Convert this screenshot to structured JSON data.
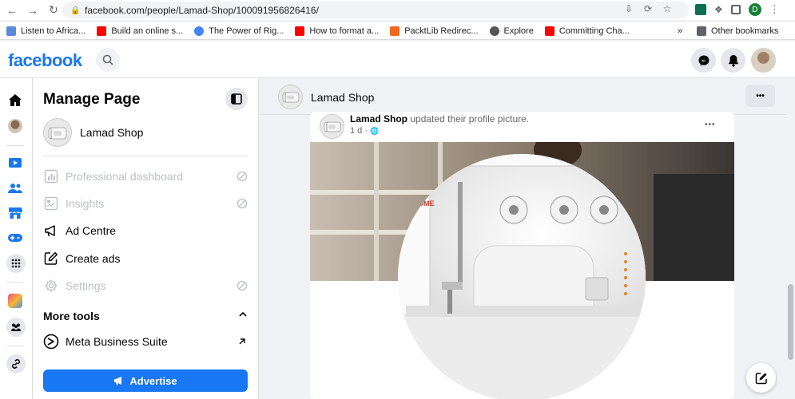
{
  "browser": {
    "url": "facebook.com/people/Lamad-Shop/100091956826416/",
    "profile_initial": "D",
    "bookmarks": [
      {
        "label": "Listen to Africa...",
        "color": "#5b8bd6"
      },
      {
        "label": "Build an online s...",
        "color": "#ff0000"
      },
      {
        "label": "The Power of Rig...",
        "color": "#4285f4"
      },
      {
        "label": "How to format a...",
        "color": "#ff0000"
      },
      {
        "label": "PacktLib Redirec...",
        "color": "#f26a21"
      },
      {
        "label": "Explore",
        "color": "#555555"
      },
      {
        "label": "Committing Cha...",
        "color": "#ff0000"
      }
    ],
    "more_bookmarks": "»",
    "other_bookmarks": "Other bookmarks"
  },
  "fb": {
    "logo": "facebook",
    "accent": "#1877f2"
  },
  "panel": {
    "title": "Manage Page",
    "page_name": "Lamad Shop",
    "menu": [
      {
        "label": "Professional dashboard",
        "disabled": true
      },
      {
        "label": "Insights",
        "disabled": true
      },
      {
        "label": "Ad Centre",
        "disabled": false
      },
      {
        "label": "Create ads",
        "disabled": false
      },
      {
        "label": "Settings",
        "disabled": true
      }
    ],
    "more_tools": "More tools",
    "meta_suite": "Meta Business Suite",
    "advertise": "Advertise"
  },
  "main": {
    "page_title": "Lamad Shop",
    "more_label": "•••",
    "post": {
      "author": "Lamad Shop",
      "action": "updated their profile picture.",
      "time": "1 d ·",
      "more_label": "•••"
    }
  }
}
